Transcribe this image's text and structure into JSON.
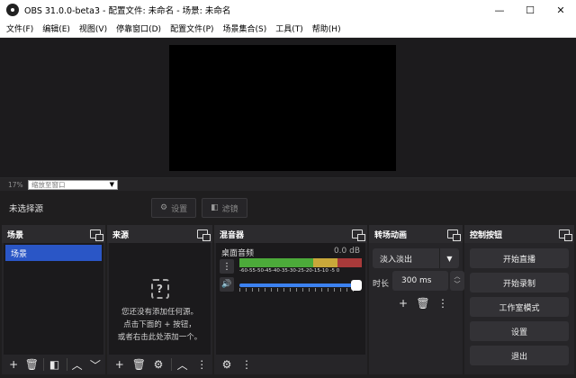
{
  "window": {
    "title": "OBS 31.0.0-beta3 - 配置文件: 未命名 - 场景: 未命名",
    "minimize": "—",
    "maximize": "☐",
    "close": "✕"
  },
  "menu": [
    "文件(F)",
    "编辑(E)",
    "视图(V)",
    "停靠窗口(D)",
    "配置文件(P)",
    "场景集合(S)",
    "工具(T)",
    "帮助(H)"
  ],
  "zoom": {
    "percent": "17%",
    "mode": "缩放至窗口"
  },
  "source_bar": {
    "no_source": "未选择源",
    "settings": "设置",
    "filters": "滤镜"
  },
  "docks": {
    "scenes": {
      "title": "场景",
      "items": [
        "场景"
      ]
    },
    "sources": {
      "title": "来源",
      "empty_line1": "您还没有添加任何源。",
      "empty_line2": "点击下面的 + 按钮，",
      "empty_line3": "或者右击此处添加一个。"
    },
    "mixer": {
      "title": "混音器",
      "channel": "桌面音频",
      "db": "0.0 dB",
      "ticks": "-60-55-50-45-40-35-30-25-20-15-10 -5  0",
      "volume": 1.0
    },
    "transitions": {
      "title": "转场动画",
      "selected": "淡入淡出",
      "duration_label": "时长",
      "duration": "300 ms"
    },
    "controls": {
      "title": "控制按钮",
      "buttons": [
        "开始直播",
        "开始录制",
        "工作室模式",
        "设置",
        "退出"
      ]
    }
  },
  "colors": {
    "accent": "#2a56c6",
    "slider": "#3c82f0",
    "background": "#1f1e1f",
    "panel": "#262528"
  }
}
